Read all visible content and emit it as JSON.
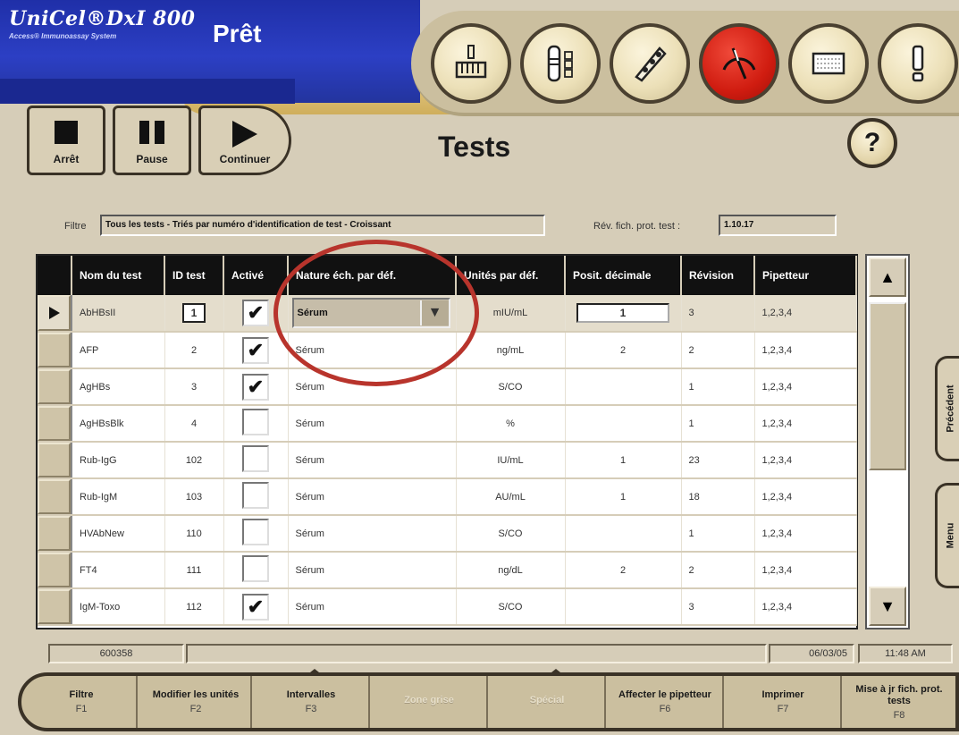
{
  "app": {
    "brand_name": "UniCel®DxI 800",
    "brand_subtitle": "Access® Immunoassay System",
    "status": "Prêt"
  },
  "nav_icons": [
    {
      "name": "supplies-icon"
    },
    {
      "name": "reagents-icon"
    },
    {
      "name": "sample-rack-icon"
    },
    {
      "name": "status-gauge-icon"
    },
    {
      "name": "results-icon"
    },
    {
      "name": "alert-icon"
    }
  ],
  "transport": {
    "stop_label": "Arrêt",
    "pause_label": "Pause",
    "continue_label": "Continuer"
  },
  "page_title": "Tests",
  "help_label": "?",
  "filter": {
    "label": "Filtre",
    "value": "Tous les tests - Triés par numéro d'identification de test - Croissant",
    "revision_label": "Rév. fich. prot. test :",
    "revision_value": "1.10.17"
  },
  "table": {
    "columns": [
      "Nom du test",
      "ID test",
      "Activé",
      "Nature éch. par déf.",
      "Unités par déf.",
      "Posit. décimale",
      "Révision",
      "Pipetteur"
    ],
    "rows": [
      {
        "name": "AbHBsII",
        "id": "1",
        "active": true,
        "sample": "Sérum",
        "units": "mIU/mL",
        "decimal": "1",
        "revision": "3",
        "pipettor": "1,2,3,4"
      },
      {
        "name": "AFP",
        "id": "2",
        "active": true,
        "sample": "Sérum",
        "units": "ng/mL",
        "decimal": "2",
        "revision": "2",
        "pipettor": "1,2,3,4"
      },
      {
        "name": "AgHBs",
        "id": "3",
        "active": true,
        "sample": "Sérum",
        "units": "S/CO",
        "decimal": "",
        "revision": "1",
        "pipettor": "1,2,3,4"
      },
      {
        "name": "AgHBsBlk",
        "id": "4",
        "active": false,
        "sample": "Sérum",
        "units": "%",
        "decimal": "",
        "revision": "1",
        "pipettor": "1,2,3,4"
      },
      {
        "name": "Rub-IgG",
        "id": "102",
        "active": false,
        "sample": "Sérum",
        "units": "IU/mL",
        "decimal": "1",
        "revision": "23",
        "pipettor": "1,2,3,4"
      },
      {
        "name": "Rub-IgM",
        "id": "103",
        "active": false,
        "sample": "Sérum",
        "units": "AU/mL",
        "decimal": "1",
        "revision": "18",
        "pipettor": "1,2,3,4"
      },
      {
        "name": "HVAbNew",
        "id": "110",
        "active": false,
        "sample": "Sérum",
        "units": "S/CO",
        "decimal": "",
        "revision": "1",
        "pipettor": "1,2,3,4"
      },
      {
        "name": "FT4",
        "id": "111",
        "active": false,
        "sample": "Sérum",
        "units": "ng/dL",
        "decimal": "2",
        "revision": "2",
        "pipettor": "1,2,3,4"
      },
      {
        "name": "IgM-Toxo",
        "id": "112",
        "active": true,
        "sample": "Sérum",
        "units": "S/CO",
        "decimal": "",
        "revision": "3",
        "pipettor": "1,2,3,4"
      }
    ]
  },
  "side_tabs": {
    "previous": "Précédent",
    "menu": "Menu"
  },
  "status_bar": {
    "serial": "600358",
    "date": "06/03/05",
    "time": "11:48 AM"
  },
  "function_keys": [
    {
      "label": "Filtre",
      "code": "F1",
      "enabled": true
    },
    {
      "label": "Modifier les unités",
      "code": "F2",
      "enabled": true
    },
    {
      "label": "Intervalles",
      "code": "F3",
      "enabled": true
    },
    {
      "label": "Zone grise",
      "code": "",
      "enabled": false
    },
    {
      "label": "Spécial",
      "code": "",
      "enabled": false
    },
    {
      "label": "Affecter le pipetteur",
      "code": "F6",
      "enabled": true
    },
    {
      "label": "Imprimer",
      "code": "F7",
      "enabled": true
    },
    {
      "label": "Mise à jr fich. prot. tests",
      "code": "F8",
      "enabled": true
    }
  ],
  "colors": {
    "brand_blue": "#2c3fc4",
    "alarm_red": "#d01c10",
    "annotation": "#b8342c",
    "panel": "#d6cdb8"
  }
}
